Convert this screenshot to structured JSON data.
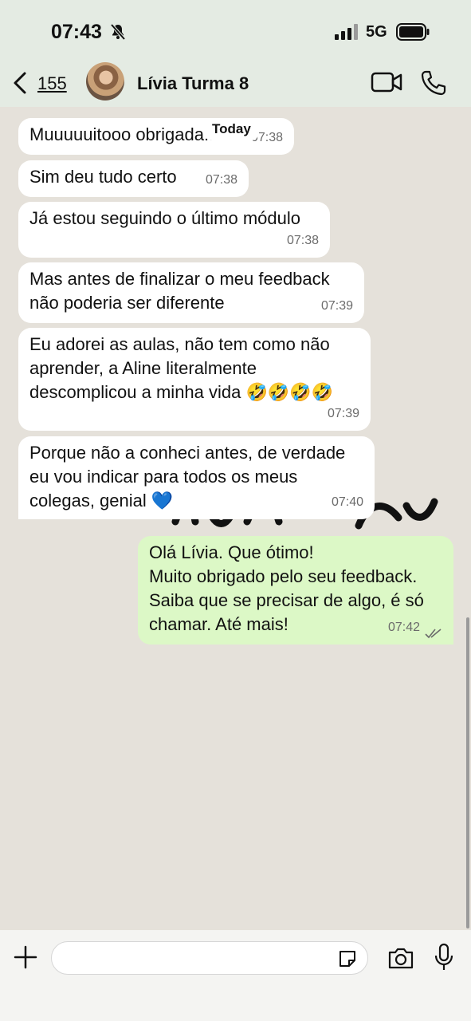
{
  "status_bar": {
    "time": "07:43",
    "network": "5G"
  },
  "header": {
    "back_count": "155",
    "contact_name": "Lívia Turma 8"
  },
  "chat": {
    "date_label": "Today",
    "messages": [
      {
        "direction": "in",
        "text": "Muuuuuitooo obrigada!!!",
        "time": "07:38"
      },
      {
        "direction": "in",
        "text": "Sim deu tudo certo",
        "time": "07:38"
      },
      {
        "direction": "in",
        "text": "Já estou seguindo o último módulo",
        "time": "07:38"
      },
      {
        "direction": "in",
        "text": "Mas antes de finalizar o meu feedback\nnão poderia ser diferente",
        "time": "07:39"
      },
      {
        "direction": "in",
        "text": "Eu adorei as aulas, não tem como não\naprender, a Aline literalmente\ndescomplicou a minha vida 🤣🤣🤣🤣",
        "time": "07:39"
      },
      {
        "direction": "in",
        "text": "Porque não a conheci antes, de verdade\neu vou indicar para todos os meus\ncolegas, genial 💙",
        "time": "07:40"
      },
      {
        "direction": "out",
        "text": "Olá Lívia. Que ótimo!\nMuito obrigado pelo seu feedback.\nSaiba que se precisar de algo, é só\nchamar. Até mais!",
        "time": "07:42",
        "status": "read"
      }
    ]
  },
  "icons": {
    "bell": "bell-slash-icon",
    "signal": "signal-bars-icon",
    "battery": "battery-icon",
    "back": "chevron-left-icon",
    "video": "video-camera-icon",
    "call": "phone-icon",
    "plus": "plus-icon",
    "sticker": "sticker-icon",
    "camera": "camera-icon",
    "mic": "microphone-icon",
    "read": "double-check-icon"
  },
  "colors": {
    "incoming_bubble": "#ffffff",
    "outgoing_bubble": "#dcf8c6",
    "chat_bg": "#e5e1da"
  }
}
